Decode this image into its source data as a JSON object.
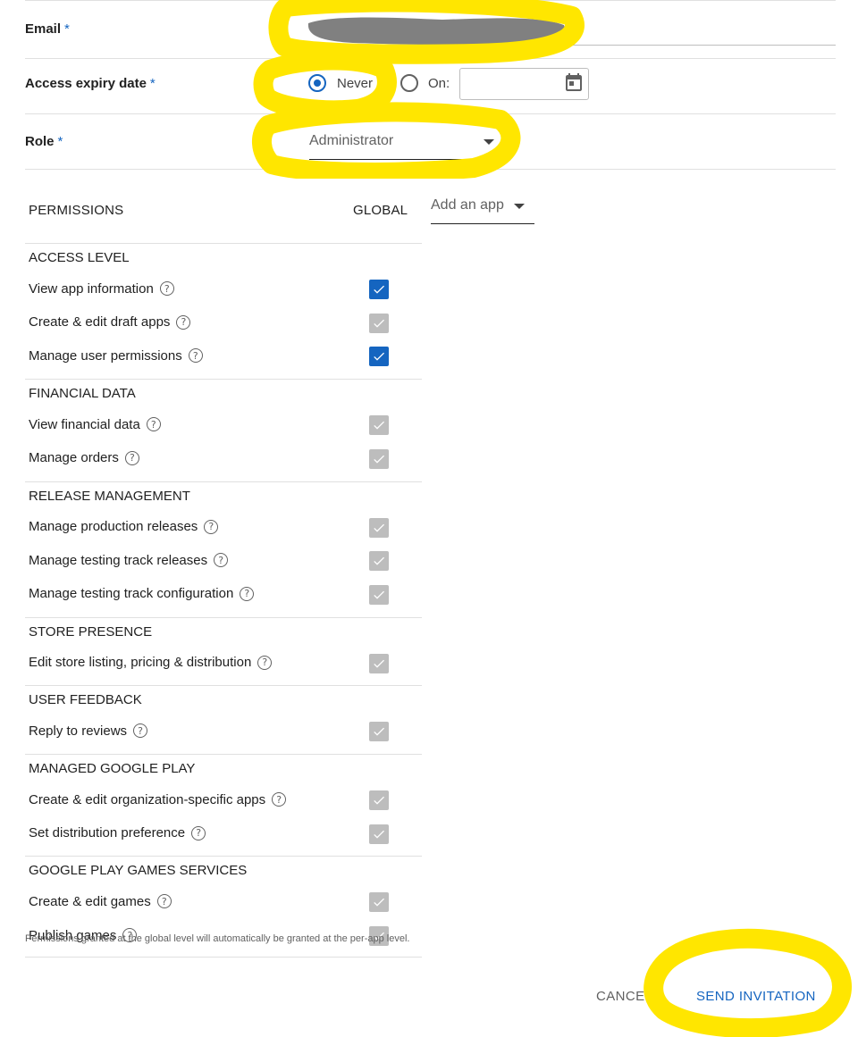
{
  "form": {
    "email_label": "Email",
    "required_mark": "*",
    "expiry_label": "Access expiry date",
    "never_label": "Never",
    "on_label": "On:",
    "role_label": "Role",
    "role_value": "Administrator",
    "expiry_selected": "Never"
  },
  "permissions": {
    "header": "PERMISSIONS",
    "global_header": "GLOBAL",
    "add_app": "Add an app",
    "sections": [
      {
        "title": "ACCESS LEVEL",
        "items": [
          {
            "label": "View app information",
            "state": "checked"
          },
          {
            "label": "Create & edit draft apps",
            "state": "checked-disabled"
          },
          {
            "label": "Manage user permissions",
            "state": "checked"
          }
        ]
      },
      {
        "title": "FINANCIAL DATA",
        "items": [
          {
            "label": "View financial data",
            "state": "checked-disabled"
          },
          {
            "label": "Manage orders",
            "state": "checked-disabled"
          }
        ]
      },
      {
        "title": "RELEASE MANAGEMENT",
        "items": [
          {
            "label": "Manage production releases",
            "state": "checked-disabled"
          },
          {
            "label": "Manage testing track releases",
            "state": "checked-disabled"
          },
          {
            "label": "Manage testing track configuration",
            "state": "checked-disabled"
          }
        ]
      },
      {
        "title": "STORE PRESENCE",
        "items": [
          {
            "label": "Edit store listing, pricing & distribution",
            "state": "checked-disabled"
          }
        ]
      },
      {
        "title": "USER FEEDBACK",
        "items": [
          {
            "label": "Reply to reviews",
            "state": "checked-disabled"
          }
        ]
      },
      {
        "title": "MANAGED GOOGLE PLAY",
        "items": [
          {
            "label": "Create & edit organization-specific apps",
            "state": "checked-disabled"
          },
          {
            "label": "Set distribution preference",
            "state": "checked-disabled"
          }
        ]
      },
      {
        "title": "GOOGLE PLAY GAMES SERVICES",
        "items": [
          {
            "label": "Create & edit games",
            "state": "checked-disabled"
          },
          {
            "label": "Publish games",
            "state": "checked-disabled"
          }
        ]
      }
    ],
    "footnote": "Permissions granted at the global level will automatically be granted at the per-app level."
  },
  "actions": {
    "cancel": "CANCEL",
    "send": "SEND INVITATION"
  },
  "icons": {
    "help": "help-circle-icon",
    "calendar": "calendar-icon",
    "check": "check-icon",
    "dropdown": "arrow-drop-down-icon"
  },
  "colors": {
    "accent": "#1565c0",
    "disabled_checkbox": "#bdbdbd",
    "highlight": "#ffe600",
    "redaction": "#808080"
  }
}
